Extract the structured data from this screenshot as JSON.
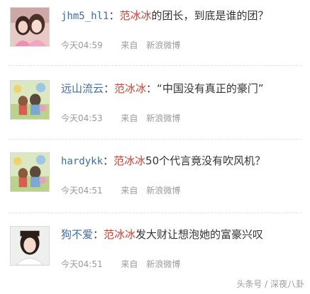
{
  "comments": [
    {
      "user": "jhm5_hl1",
      "separator": "：",
      "mention": "范冰冰",
      "text": "的团长，到底是谁的团？",
      "time": "今天04:59",
      "from_label": "来自",
      "source": "新浪微博",
      "avatar_icon": "two-girls-photo-icon"
    },
    {
      "user": "远山流云",
      "separator": "：",
      "mention": "范冰冰",
      "text": "：“中国没有真正的豪门”",
      "time": "今天04:53",
      "from_label": "来自",
      "source": "新浪微博",
      "avatar_icon": "cartoon-default-avatar-icon"
    },
    {
      "user": "hardykk",
      "separator": "：",
      "mention": "范冰冰",
      "text": "50个代言竟没有吹风机？",
      "time": "今天04:51",
      "from_label": "来自",
      "source": "新浪微博",
      "avatar_icon": "cartoon-default-avatar-icon"
    },
    {
      "user": "狗不爱",
      "separator": "：",
      "mention": "范冰冰",
      "text": "发大财让想泡她的富豪兴叹",
      "time": "今天04:51",
      "from_label": "来自",
      "source": "新浪微博",
      "avatar_icon": "girl-photo-icon"
    }
  ],
  "watermark": "头条号 / 深夜八卦"
}
